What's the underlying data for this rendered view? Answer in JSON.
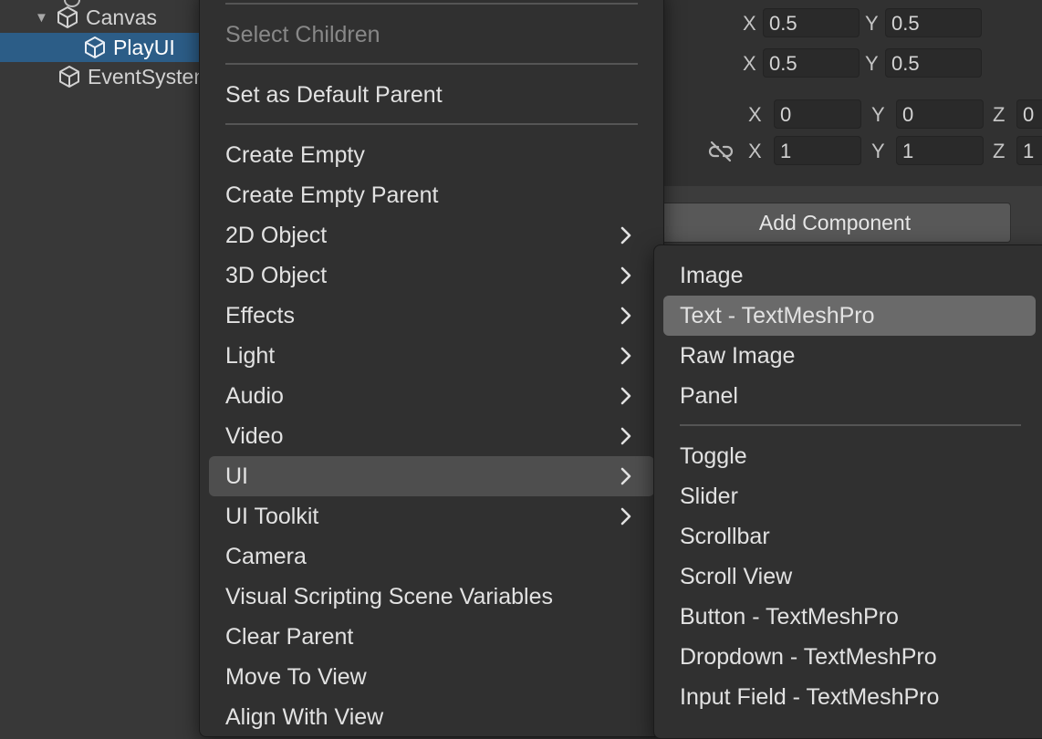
{
  "hierarchy": {
    "items": [
      {
        "label": "Canvas",
        "expanded": true
      },
      {
        "label": "PlayUI",
        "selected": true
      },
      {
        "label": "EventSystem"
      }
    ]
  },
  "inspector": {
    "row1": {
      "x_label": "X",
      "x": "0.5",
      "y_label": "Y",
      "y": "0.5"
    },
    "row2": {
      "x_label": "X",
      "x": "0.5",
      "y_label": "Y",
      "y": "0.5"
    },
    "rotation": {
      "x_label": "X",
      "x": "0",
      "y_label": "Y",
      "y": "0",
      "z_label": "Z",
      "z": "0"
    },
    "scale": {
      "x_label": "X",
      "x": "1",
      "y_label": "Y",
      "y": "1",
      "z_label": "Z",
      "z": "1"
    },
    "link_icon": "unlink-icon",
    "add_component_label": "Add Component"
  },
  "context_menu": {
    "items": [
      {
        "label": "Select Children",
        "disabled": true
      },
      {
        "label": "Set as Default Parent"
      },
      {
        "label": "Create Empty"
      },
      {
        "label": "Create Empty Parent"
      },
      {
        "label": "2D Object",
        "submenu": true
      },
      {
        "label": "3D Object",
        "submenu": true
      },
      {
        "label": "Effects",
        "submenu": true
      },
      {
        "label": "Light",
        "submenu": true
      },
      {
        "label": "Audio",
        "submenu": true
      },
      {
        "label": "Video",
        "submenu": true
      },
      {
        "label": "UI",
        "submenu": true,
        "highlighted": true
      },
      {
        "label": "UI Toolkit",
        "submenu": true
      },
      {
        "label": "Camera"
      },
      {
        "label": "Visual Scripting Scene Variables"
      },
      {
        "label": "Clear Parent"
      },
      {
        "label": "Move To View"
      },
      {
        "label": "Align With View"
      }
    ]
  },
  "ui_submenu": {
    "items": [
      {
        "label": "Image"
      },
      {
        "label": "Text - TextMeshPro",
        "highlighted": true
      },
      {
        "label": "Raw Image"
      },
      {
        "label": "Panel"
      },
      {
        "label": "Toggle"
      },
      {
        "label": "Slider"
      },
      {
        "label": "Scrollbar"
      },
      {
        "label": "Scroll View"
      },
      {
        "label": "Button - TextMeshPro"
      },
      {
        "label": "Dropdown - TextMeshPro"
      },
      {
        "label": "Input Field - TextMeshPro"
      }
    ]
  },
  "colors": {
    "menu_bg": "#303030",
    "menu_highlight": "#4e4e4e",
    "submenu_highlight": "#6a6a6a",
    "selection_blue": "#2c5d87",
    "panel_bg": "#383838"
  }
}
